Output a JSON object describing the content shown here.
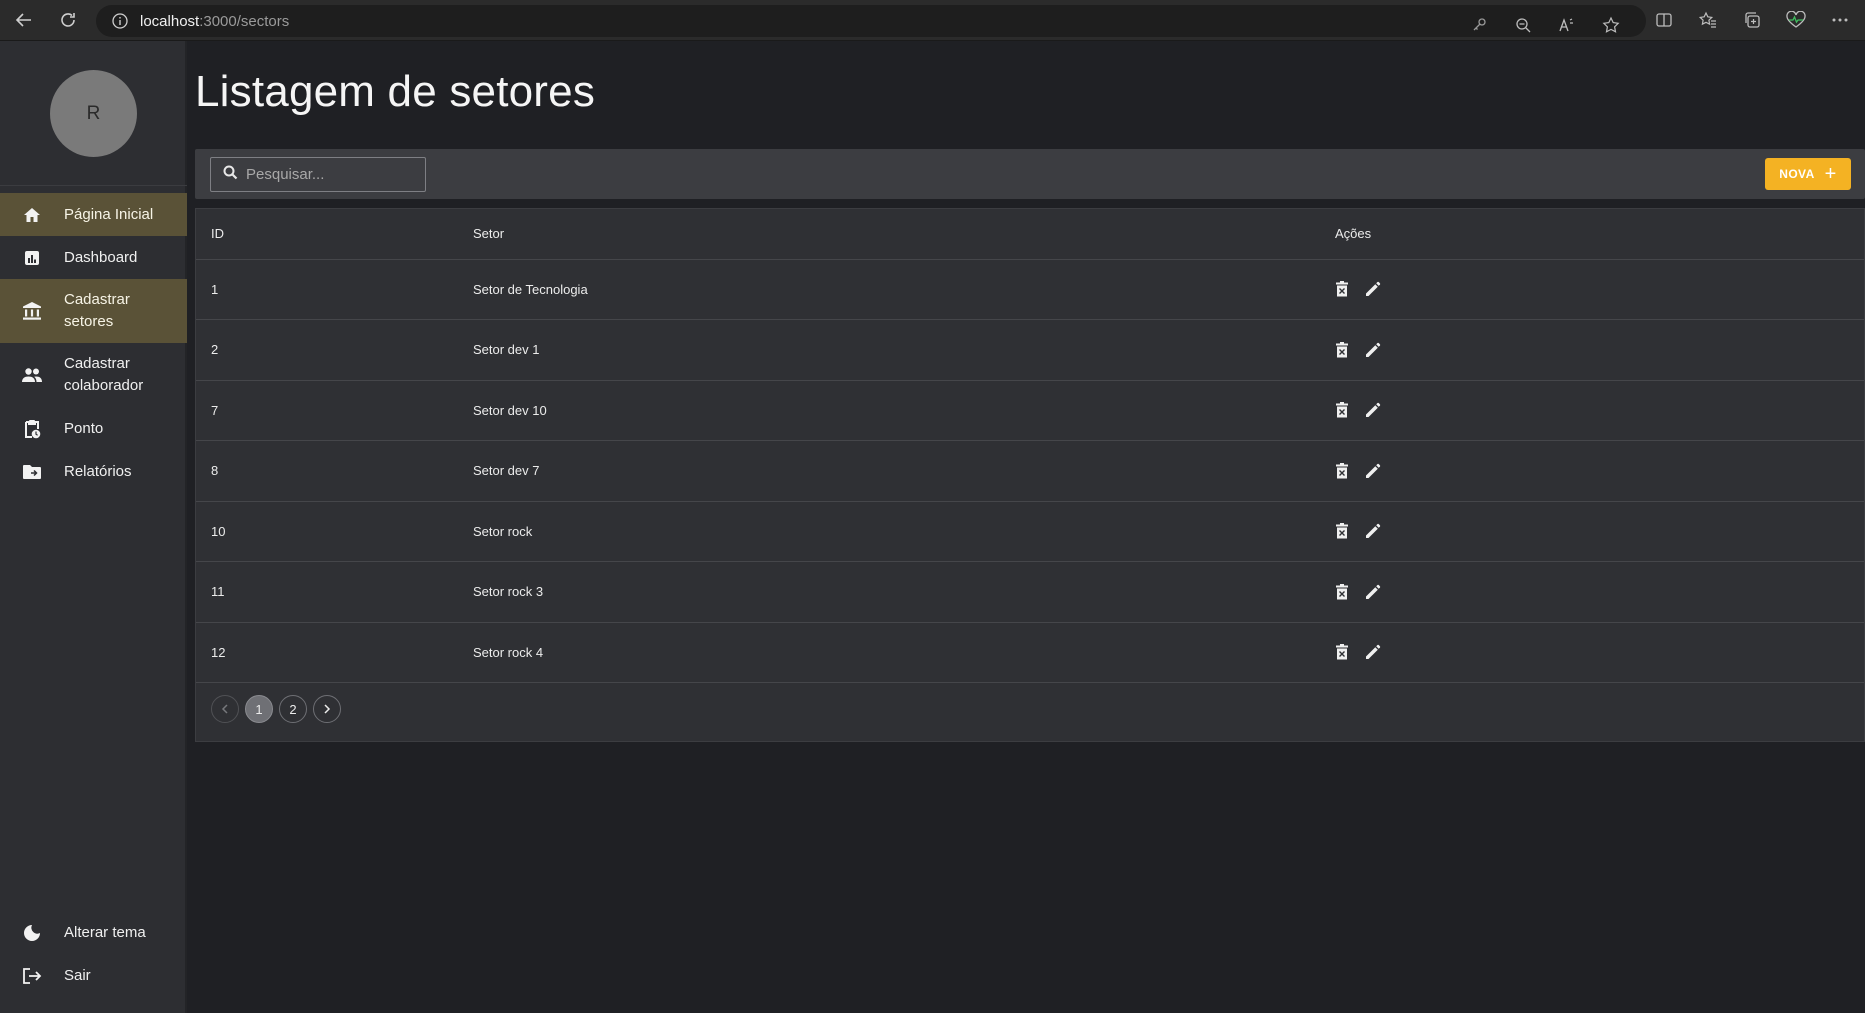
{
  "browser": {
    "url_host": "localhost",
    "url_path": ":3000/sectors"
  },
  "user": {
    "avatar_initial": "R"
  },
  "sidebar": {
    "items": [
      {
        "label": "Página Inicial",
        "icon": "home-icon",
        "active": true
      },
      {
        "label": "Dashboard",
        "icon": "chart-icon",
        "active": false
      },
      {
        "label": "Cadastrar setores",
        "icon": "bank-icon",
        "active": true
      },
      {
        "label": "Cadastrar colaborador",
        "icon": "people-icon",
        "active": false
      },
      {
        "label": "Ponto",
        "icon": "clipboard-clock-icon",
        "active": false
      },
      {
        "label": "Relatórios",
        "icon": "folder-icon",
        "active": false
      }
    ],
    "bottom": [
      {
        "label": "Alterar tema",
        "icon": "moon-icon"
      },
      {
        "label": "Sair",
        "icon": "logout-icon"
      }
    ]
  },
  "main": {
    "title": "Listagem de setores",
    "search": {
      "placeholder": "Pesquisar...",
      "value": ""
    },
    "new_button": "NOVA",
    "table": {
      "headers": [
        "ID",
        "Setor",
        "Ações"
      ],
      "rows": [
        {
          "id": "1",
          "sector": "Setor de Tecnologia"
        },
        {
          "id": "2",
          "sector": "Setor dev 1"
        },
        {
          "id": "7",
          "sector": "Setor dev 10"
        },
        {
          "id": "8",
          "sector": "Setor dev 7"
        },
        {
          "id": "10",
          "sector": "Setor rock"
        },
        {
          "id": "11",
          "sector": "Setor rock 3"
        },
        {
          "id": "12",
          "sector": "Setor rock 4"
        }
      ]
    },
    "pagination": {
      "pages": [
        "1",
        "2"
      ],
      "current": "1"
    }
  },
  "colors": {
    "accent": "#f4b223",
    "active_menu": "#5a5237",
    "sidebar_bg": "#2d2e32",
    "page_bg": "#1f2024"
  }
}
